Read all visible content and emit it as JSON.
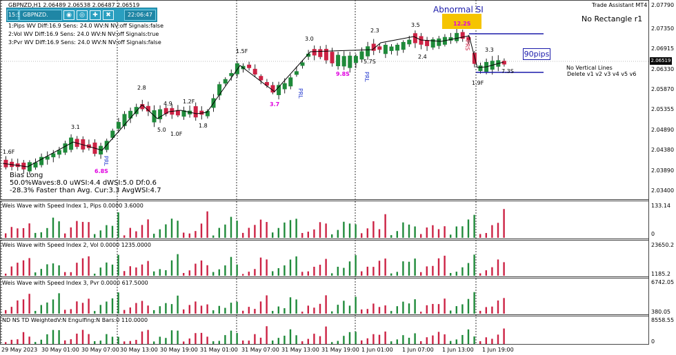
{
  "window": {
    "symbol_header": "GBPNZD,H1  2.06489 2.06538 2.06487 2.06519",
    "indicator_name": "Trade Assistant MT4",
    "rectangle_status": "No Rectangle r1"
  },
  "toolbar": {
    "badge": "15:5",
    "symbol": "GBPNZD.",
    "time": "22:06:47",
    "icons": [
      "camera-icon",
      "eye-icon",
      "crosshair-icon",
      "x-box-icon"
    ]
  },
  "settings_lines": [
    "1:Pips  WV Diff:16.9 Sens: 24.0 WV:N NV:off Signals:false",
    "2:Vol   WV Diff:16.9 Sens: 24.0 WV:N NV:off Signals:true",
    "3:Pvr   WV Diff:16.9 Sens: 24.0 WV:N NV:off Signals:false"
  ],
  "abnormal_label": "Abnormal SI",
  "abnormal_value": "12.2S",
  "pips_label": "90pips",
  "vertical_lines": {
    "title": "No Vertical Lines",
    "delete": "Delete  v1 v2 v3 v4 v5 v6"
  },
  "bias": {
    "line1": "Bias Long",
    "line2": "50.0%Waves:8.0 uWSI:4.4 dWSI:5.0 Df:0.6",
    "line3": "-28.3% Faster than Avg. Cur:3.3 AvgWSI:4.7"
  },
  "price_axis": {
    "current": "2.06519",
    "labels": [
      "2.07790",
      "2.07350",
      "2.06915",
      "2.06330",
      "2.05870",
      "2.05355",
      "2.04890",
      "2.04380",
      "2.03890",
      "2.03400"
    ]
  },
  "wave_labels": {
    "black": [
      "1.6F",
      "3.1",
      "2.8",
      "4.9",
      "1.2F",
      "1.5F",
      "3.0",
      "2.3",
      "3.5",
      "5.0",
      "1.0F",
      "1.8",
      "5.7S",
      "2.4",
      "3.3",
      "1.9F",
      "7.3S"
    ],
    "magenta": [
      "6.8S",
      "3.7",
      "9.8S"
    ],
    "blue_rotated": [
      "PRL",
      "PRL",
      "PRL",
      "PRS"
    ]
  },
  "subwindows": [
    {
      "title": "Weis Wave with Speed Index 1, Pips 0.0000 3.6000",
      "axis_top": "133.14",
      "axis_bottom": "0"
    },
    {
      "title": "Weis Wave with Speed Index 2, Vol  0.0000 1235.0000",
      "axis_top": "23650.2",
      "axis_bottom": "1185.2"
    },
    {
      "title": "Weis Wave with Speed Index 3, Pvr  0.0000 617.5000",
      "axis_top": "6742.05",
      "axis_bottom": "380.05"
    },
    {
      "title": "ND NS TD WeightedV:N Engulfing:N Bars:0   110.0000",
      "axis_top": "8558.55",
      "axis_bottom": "0"
    }
  ],
  "time_axis": [
    "29 May 2023",
    "30 May 01:00",
    "30 May 07:00",
    "30 May 13:00",
    "30 May 19:00",
    "31 May 01:00",
    "31 May 07:00",
    "31 May 13:00",
    "31 May 19:00",
    "1 Jun 01:00",
    "1 Jun 07:00",
    "1 Jun 13:00",
    "1 Jun 19:00"
  ],
  "colors": {
    "bull": "#1f8a3a",
    "bear": "#cc2244",
    "wave_line": "#000000",
    "blue_line": "#1a1aaa",
    "abnormal_bg": "#f5c400",
    "magenta": "#e000e0"
  }
}
